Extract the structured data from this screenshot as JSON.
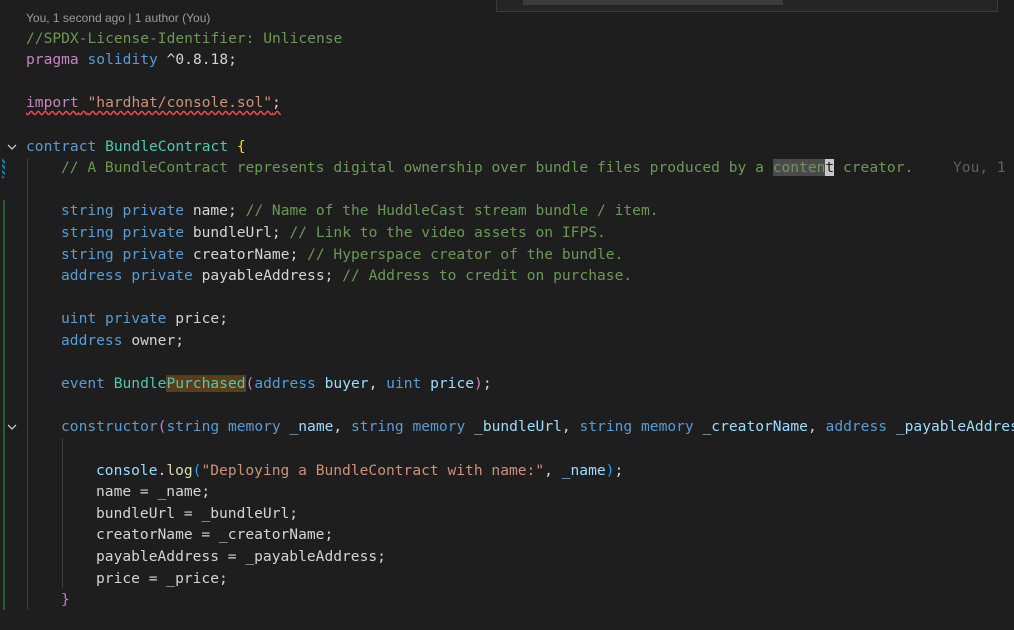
{
  "codelens": "You, 1 second ago | 1 author (You)",
  "blame": "You, 1",
  "lines": {
    "l1": "//SPDX-License-Identifier: Unlicense",
    "l2_kw": "pragma",
    "l2_ident": "solidity",
    "l2_ver": "^0.8.18;",
    "l4_kw": "import",
    "l4_str": "\"hardhat/console.sol\"",
    "l4_semi": ";",
    "l6_kw": "contract",
    "l6_name": "BundleContract",
    "l6_brace": "{",
    "l7_a": "// A BundleContract represents digital ownership over bundle files produced by a ",
    "l7_b": "conten",
    "l7_c": "t",
    "l7_d": " creator.",
    "l9_t": "string",
    "l9_m": "private",
    "l9_n": "name;",
    "l9_c": "// Name of the HuddleCast stream bundle / item.",
    "l10_t": "string",
    "l10_m": "private",
    "l10_n": "bundleUrl;",
    "l10_c": "// Link to the video assets on IFPS.",
    "l11_t": "string",
    "l11_m": "private",
    "l11_n": "creatorName;",
    "l11_c": "// Hyperspace creator of the bundle.",
    "l12_t": "address",
    "l12_m": "private",
    "l12_n": "payableAddress;",
    "l12_c": "// Address to credit on purchase.",
    "l14_t": "uint",
    "l14_m": "private",
    "l14_n": "price;",
    "l15_t": "address",
    "l15_n": "owner;",
    "l17_kw": "event",
    "l17_n1": "Bundle",
    "l17_n2": "Purchased",
    "l17_p1": "(",
    "l17_t1": "address",
    "l17_a1": "buyer",
    "l17_comma": ", ",
    "l17_t2": "uint",
    "l17_a2": "price",
    "l17_p2": ")",
    "l17_semi": ";",
    "l19_kw": "constructor",
    "l19_p": "(",
    "l19_s1": "string",
    "l19_m1": "memory",
    "l19_a1": "_name",
    "l19_s2": "string",
    "l19_m2": "memory",
    "l19_a2": "_bundleUrl",
    "l19_s3": "string",
    "l19_m3": "memory",
    "l19_a3": "_creatorName",
    "l19_s4": "address",
    "l19_a4": "_payableAddress",
    "l21_obj": "console",
    "l21_dot": ".",
    "l21_fn": "log",
    "l21_p1": "(",
    "l21_str": "\"Deploying a BundleContract with name:\"",
    "l21_rest": ", ",
    "l21_arg": "_name",
    "l21_p2": ")",
    "l21_semi": ";",
    "l22": "name = _name;",
    "l23": "bundleUrl = _bundleUrl;",
    "l24": "creatorName = _creatorName;",
    "l25": "payableAddress = _payableAddress;",
    "l26": "price = _price;",
    "l27": "}"
  }
}
